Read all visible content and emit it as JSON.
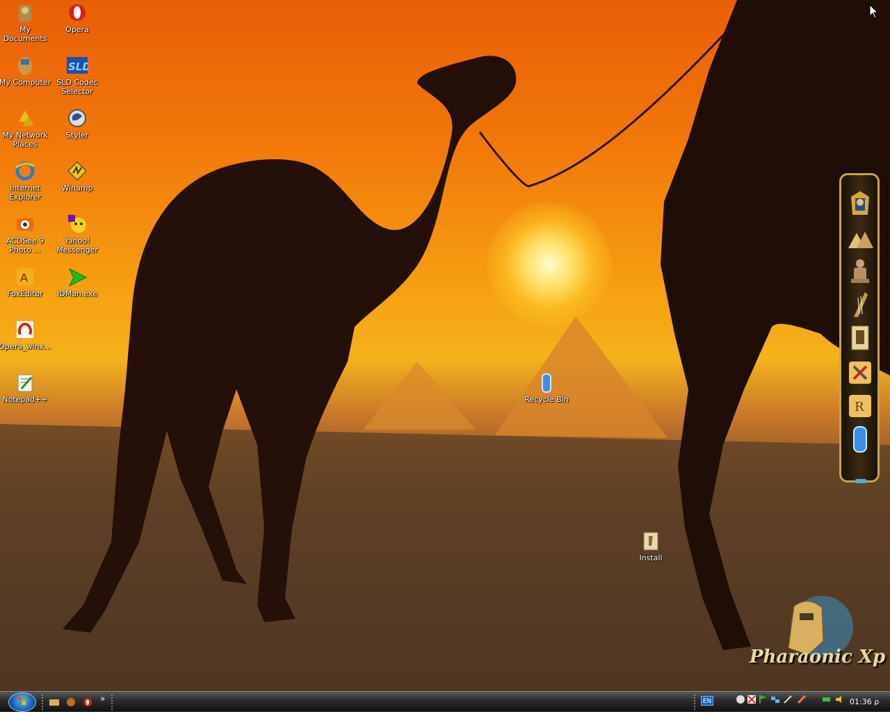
{
  "desktop": {
    "icons_left": [
      {
        "label": "My Documents",
        "icon": "my-documents-icon"
      },
      {
        "label": "My Computer",
        "icon": "my-computer-icon"
      },
      {
        "label": "My Network Places",
        "icon": "network-places-icon"
      },
      {
        "label": "Internet Explorer",
        "icon": "internet-explorer-icon"
      },
      {
        "label": "ACDSee 9 Photo ...",
        "icon": "acdsee-icon"
      },
      {
        "label": "FoxEditor",
        "icon": "foxeditor-icon"
      },
      {
        "label": "Opera_winx...",
        "icon": "opera-installer-icon"
      },
      {
        "label": "Notepad++",
        "icon": "notepadpp-icon"
      }
    ],
    "icons_right": [
      {
        "label": "Opera",
        "icon": "opera-icon"
      },
      {
        "label": "SLD Codec Selector",
        "icon": "sld-codec-icon"
      },
      {
        "label": "Styler",
        "icon": "styler-icon"
      },
      {
        "label": "Winamp",
        "icon": "winamp-icon"
      },
      {
        "label": "Yahoo! Messenger",
        "icon": "yahoo-messenger-icon"
      },
      {
        "label": "IDMan.exe",
        "icon": "idman-icon"
      }
    ],
    "recycle_bin": {
      "label": "Recycle Bin"
    },
    "install": {
      "label": "Install"
    },
    "logo_text": "Pharaonic Xp"
  },
  "dock": {
    "items": [
      "pharaoh-mask-icon",
      "pyramids-icon",
      "scribe-statue-icon",
      "harp-icon",
      "papyrus-icon",
      "tools-icon",
      "scroll-icon",
      "recycle-bin-icon"
    ]
  },
  "taskbar": {
    "language": "EN",
    "clock": "01:36 ρ",
    "more_label": "»"
  },
  "colors": {
    "accent": "#f4a015",
    "taskbar": "#2d2d2d",
    "dock_border": "#c7a54a"
  }
}
